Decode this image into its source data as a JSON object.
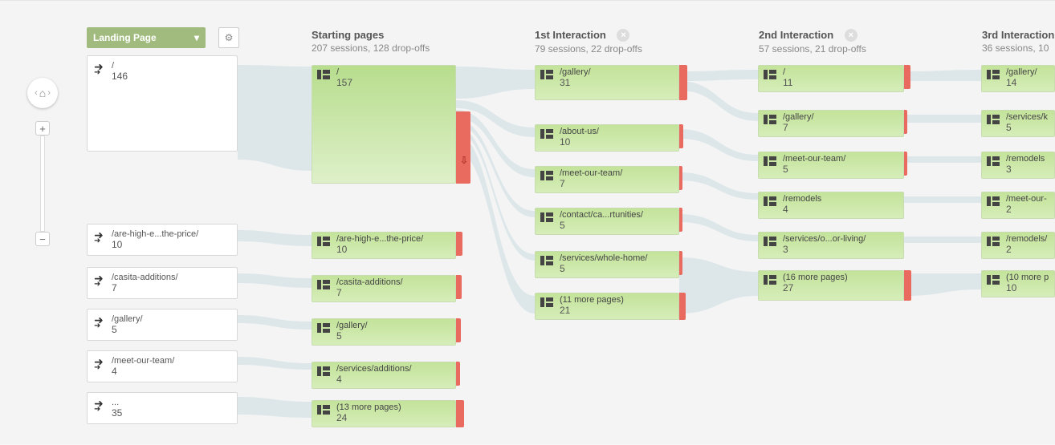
{
  "dimension": {
    "label": "Landing Page"
  },
  "columns": [
    {
      "title": "Starting pages",
      "subtitle": "207 sessions, 128 drop-offs",
      "closable": false
    },
    {
      "title": "1st Interaction",
      "subtitle": "79 sessions, 22 drop-offs",
      "closable": true
    },
    {
      "title": "2nd Interaction",
      "subtitle": "57 sessions, 21 drop-offs",
      "closable": true
    },
    {
      "title": "3rd Interaction",
      "subtitle": "36 sessions, 10",
      "closable": false
    }
  ],
  "sources": [
    {
      "label": "/",
      "value": "146"
    },
    {
      "label": "/are-high-e...the-price/",
      "value": "10"
    },
    {
      "label": "/casita-additions/",
      "value": "7"
    },
    {
      "label": "/gallery/",
      "value": "5"
    },
    {
      "label": "/meet-our-team/",
      "value": "4"
    },
    {
      "label": "...",
      "value": "35"
    }
  ],
  "starting": [
    {
      "label": "/",
      "value": "157"
    },
    {
      "label": "/are-high-e...the-price/",
      "value": "10"
    },
    {
      "label": "/casita-additions/",
      "value": "7"
    },
    {
      "label": "/gallery/",
      "value": "5"
    },
    {
      "label": "/services/additions/",
      "value": "4"
    },
    {
      "label": "(13 more pages)",
      "value": "24"
    }
  ],
  "int1": [
    {
      "label": "/gallery/",
      "value": "31"
    },
    {
      "label": "/about-us/",
      "value": "10"
    },
    {
      "label": "/meet-our-team/",
      "value": "7"
    },
    {
      "label": "/contact/ca...rtunities/",
      "value": "5"
    },
    {
      "label": "/services/whole-home/",
      "value": "5"
    },
    {
      "label": "(11 more pages)",
      "value": "21"
    }
  ],
  "int2": [
    {
      "label": "/",
      "value": "11"
    },
    {
      "label": "/gallery/",
      "value": "7"
    },
    {
      "label": "/meet-our-team/",
      "value": "5"
    },
    {
      "label": "/remodels",
      "value": "4"
    },
    {
      "label": "/services/o...or-living/",
      "value": "3"
    },
    {
      "label": "(16 more pages)",
      "value": "27"
    }
  ],
  "int3": [
    {
      "label": "/gallery/",
      "value": "14"
    },
    {
      "label": "/services/k",
      "value": "5"
    },
    {
      "label": "/remodels",
      "value": "3"
    },
    {
      "label": "/meet-our-",
      "value": "2"
    },
    {
      "label": "/remodels/",
      "value": "2"
    },
    {
      "label": "(10 more p",
      "value": "10"
    }
  ]
}
